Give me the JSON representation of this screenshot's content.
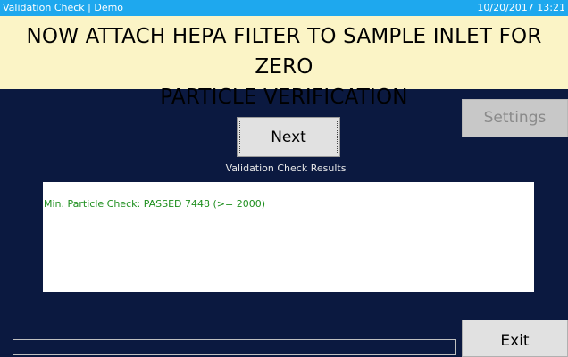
{
  "window": {
    "title": "Validation Check | Demo",
    "datetime": "10/20/2017 13:21"
  },
  "banner": {
    "line1": "NOW ATTACH HEPA FILTER TO SAMPLE INLET FOR ZERO",
    "line2": "PARTICLE VERIFICATION"
  },
  "buttons": {
    "next_label": "Next",
    "settings_label": "Settings",
    "exit_label": "Exit"
  },
  "results": {
    "label": "Validation Check Results",
    "lines": [
      "Min. Particle Check: PASSED 7448 (>= 2000)"
    ]
  },
  "progress": {
    "value": 0
  },
  "colors": {
    "background": "#0b1940",
    "titlebar": "#1ea8ee",
    "banner": "#fbf4c6",
    "pass_text": "#1f8f1f"
  }
}
